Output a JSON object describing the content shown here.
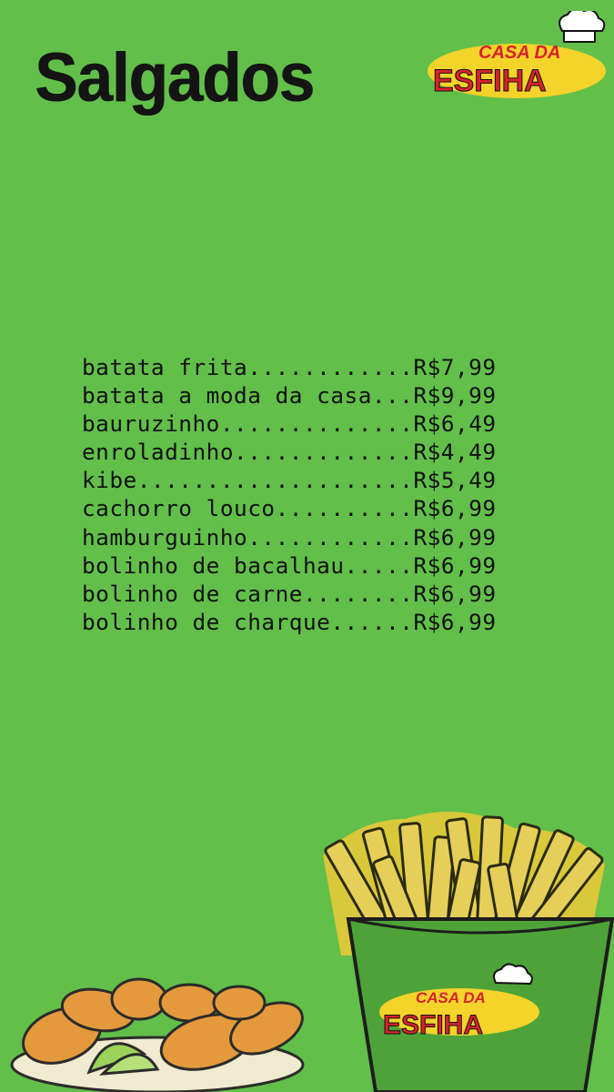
{
  "page": {
    "title": "Salgados",
    "background": "#62bf4a"
  },
  "brand": {
    "line1": "CASA DA",
    "line2": "ESFIHA",
    "yellow": "#f4d32a",
    "red": "#d8232a"
  },
  "menu": {
    "items": [
      {
        "name": "batata frita",
        "dots": "............",
        "price": "R$7,99"
      },
      {
        "name": "batata a moda da casa",
        "dots": "...",
        "price": "R$9,99"
      },
      {
        "name": "bauruzinho",
        "dots": "..............",
        "price": "R$6,49"
      },
      {
        "name": "enroladinho",
        "dots": ".............",
        "price": "R$4,49"
      },
      {
        "name": "kibe",
        "dots": "....................",
        "price": "R$5,49"
      },
      {
        "name": "cachorro louco",
        "dots": "..........",
        "price": "R$6,99"
      },
      {
        "name": "hamburguinho",
        "dots": "............",
        "price": "R$6,99"
      },
      {
        "name": "bolinho de bacalhau",
        "dots": ".....",
        "price": "R$6,99"
      },
      {
        "name": "bolinho de carne",
        "dots": "........",
        "price": "R$6,99"
      },
      {
        "name": "bolinho de charque",
        "dots": "......",
        "price": "R$6,99"
      }
    ]
  },
  "illustrations": {
    "fries": {
      "icon": "fries-box-icon"
    },
    "snacks": {
      "icon": "croquette-plate-icon"
    }
  }
}
